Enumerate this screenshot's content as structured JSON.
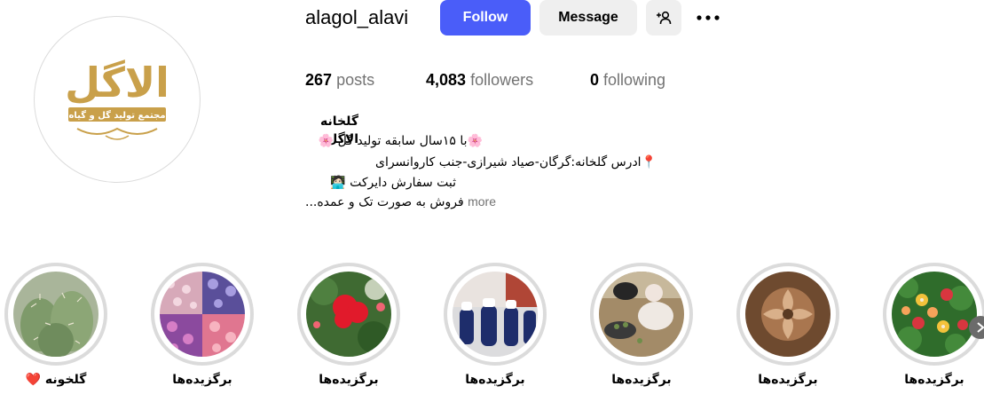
{
  "profile": {
    "username": "alagol_alavi",
    "follow_label": "Follow",
    "message_label": "Message",
    "logo_text": "الاگل",
    "logo_subtext": "مجتمع تولید گل و گیاه"
  },
  "stats": {
    "posts_count": "267",
    "posts_label": "posts",
    "followers_count": "4,083",
    "followers_label": "followers",
    "following_count": "0",
    "following_label": "following"
  },
  "bio": {
    "name": "گلخانه الاگل",
    "line1": "🌸با ۱۵سال سابقه تولید گل 🌸",
    "line2": "📍ادرس گلخانه:گرگان-صیاد شیرازی-جنب کاروانسرای",
    "line3": "ثبت سفارش دایرکت 🧑🏻‍💻",
    "line4": "فروش به صورت تک و عمده...",
    "more_label": "more"
  },
  "highlights": [
    {
      "label": "گلخونه ❤️",
      "icon": "cactus-image"
    },
    {
      "label": "برگزیده‌ها",
      "icon": "flower-collage-image"
    },
    {
      "label": "برگزیده‌ها",
      "icon": "red-geranium-image"
    },
    {
      "label": "برگزیده‌ها",
      "icon": "blue-vases-image"
    },
    {
      "label": "برگزیده‌ها",
      "icon": "planting-image"
    },
    {
      "label": "برگزیده‌ها",
      "icon": "carved-art-image"
    },
    {
      "label": "برگزیده‌ها",
      "icon": "primrose-image"
    }
  ],
  "colors": {
    "accent": "#4a5df9",
    "logo_gold": "#c9a04a",
    "muted": "#737373",
    "button_bg": "#efefef",
    "ring": "#dbdbdb"
  }
}
